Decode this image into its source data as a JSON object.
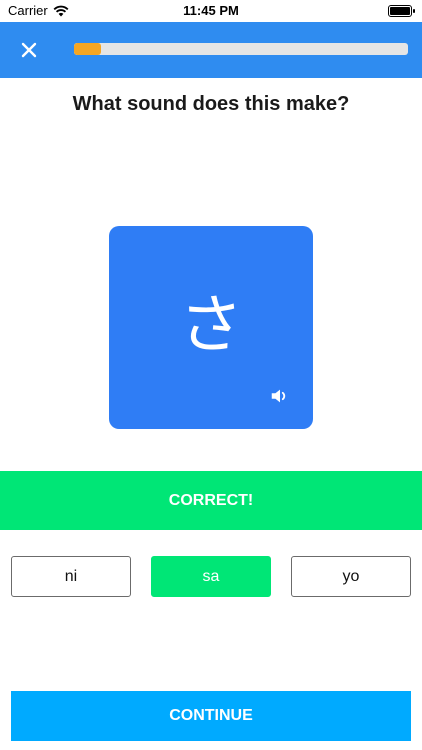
{
  "status_bar": {
    "carrier": "Carrier",
    "time": "11:45 PM",
    "icons": [
      "wifi-icon",
      "battery-icon"
    ]
  },
  "top_bar": {
    "close_icon": "close-icon",
    "progress_fraction": 0.08,
    "colors": {
      "bar": "#2f8cf0",
      "progress_fill": "#f5a623",
      "progress_track": "#e5e5e5"
    }
  },
  "question": "What sound does this make?",
  "card": {
    "character": "さ",
    "sound_icon": "speaker-icon",
    "color": "#2f7df5"
  },
  "feedback": {
    "text": "CORRECT!",
    "color": "#00e676"
  },
  "options": [
    {
      "label": "ni",
      "selected": false
    },
    {
      "label": "sa",
      "selected": true
    },
    {
      "label": "yo",
      "selected": false
    }
  ],
  "continue_label": "CONTINUE",
  "continue_color": "#00aaff"
}
